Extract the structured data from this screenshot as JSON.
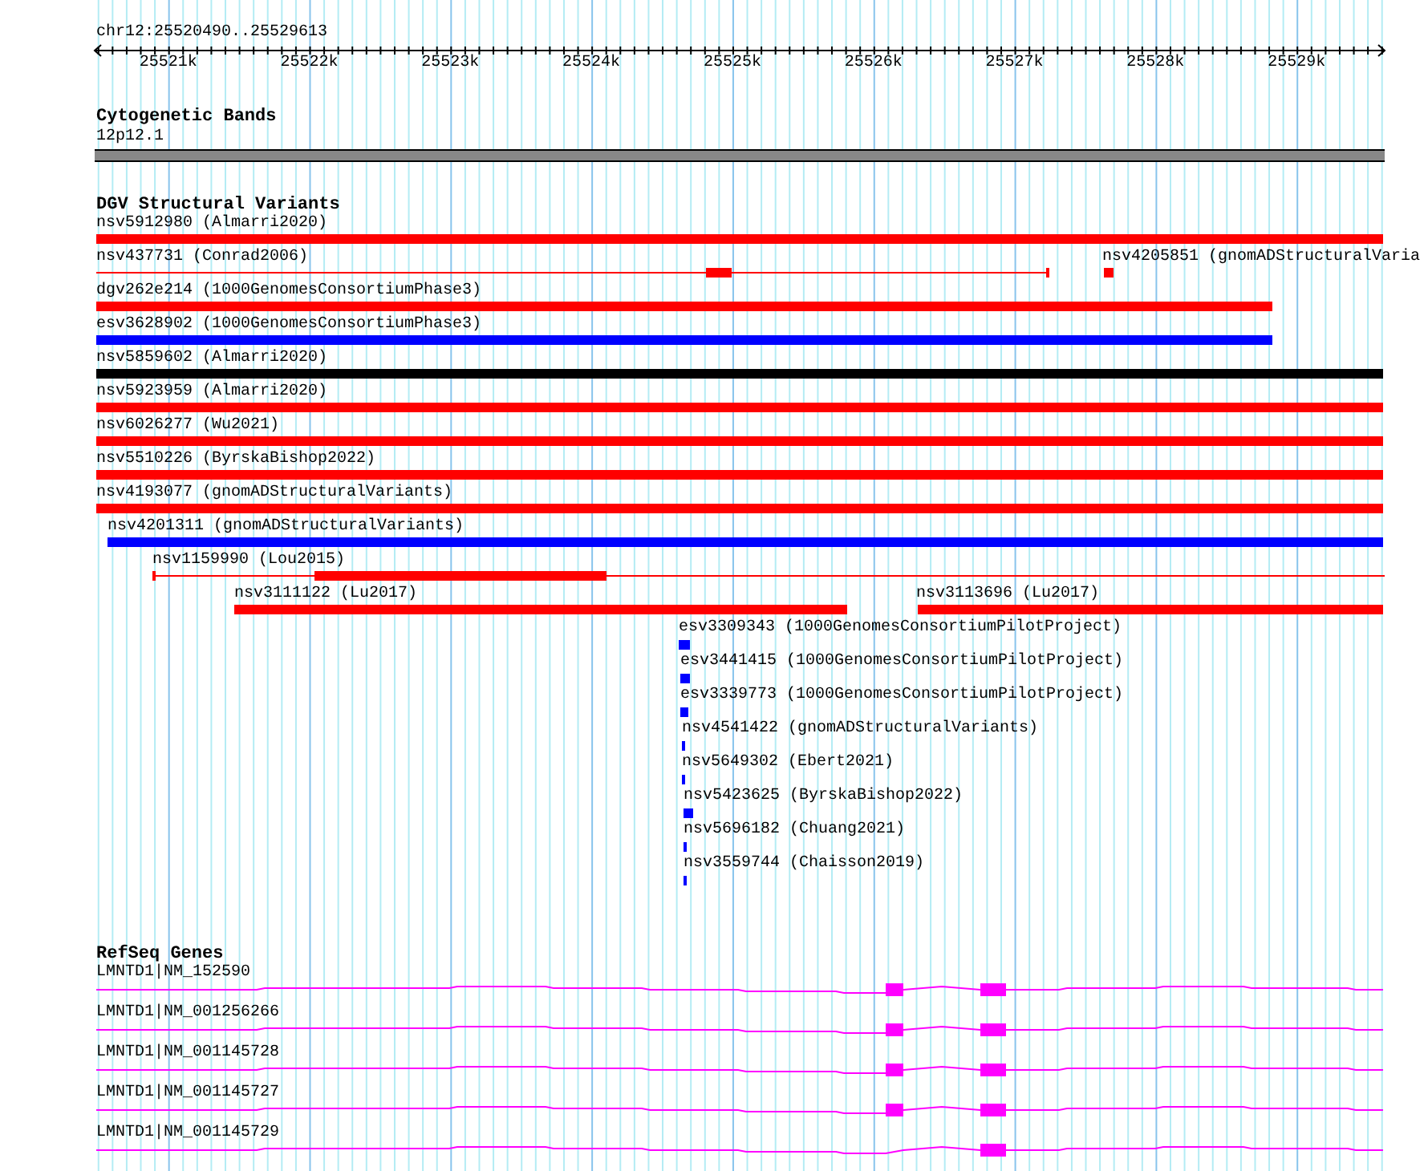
{
  "ruler": {
    "range": "chr12:25520490..25529613",
    "ticks": [
      "25521k",
      "25522k",
      "25523k",
      "25524k",
      "25525k",
      "25526k",
      "25527k",
      "25528k",
      "25529k"
    ]
  },
  "cytoband_track": {
    "title": "Cytogenetic Bands",
    "band": "12p12.1"
  },
  "dgv_track": {
    "title": "DGV Structural Variants",
    "features": [
      {
        "label": "nsv5912980 (Almarri2020)",
        "color": "#ff0000"
      },
      {
        "label": "nsv437731 (Conrad2006)",
        "color": "#ff0000"
      },
      {
        "label": "nsv4205851 (gnomADStructuralVaria",
        "color": "#ff0000"
      },
      {
        "label": "dgv262e214 (1000GenomesConsortiumPhase3)",
        "color": "#ff0000"
      },
      {
        "label": "esv3628902 (1000GenomesConsortiumPhase3)",
        "color": "#0000ff"
      },
      {
        "label": "nsv5859602 (Almarri2020)",
        "color": "#000000"
      },
      {
        "label": "nsv5923959 (Almarri2020)",
        "color": "#ff0000"
      },
      {
        "label": "nsv6026277 (Wu2021)",
        "color": "#ff0000"
      },
      {
        "label": "nsv5510226 (ByrskaBishop2022)",
        "color": "#ff0000"
      },
      {
        "label": "nsv4193077 (gnomADStructuralVariants)",
        "color": "#ff0000"
      },
      {
        "label": "nsv4201311 (gnomADStructuralVariants)",
        "color": "#0000ff"
      },
      {
        "label": "nsv1159990 (Lou2015)",
        "color": "#ff0000"
      },
      {
        "label": "nsv3111122 (Lu2017)",
        "color": "#ff0000"
      },
      {
        "label": "nsv3113696 (Lu2017)",
        "color": "#ff0000"
      },
      {
        "label": "esv3309343 (1000GenomesConsortiumPilotProject)",
        "color": "#0000ff"
      },
      {
        "label": "esv3441415 (1000GenomesConsortiumPilotProject)",
        "color": "#0000ff"
      },
      {
        "label": "esv3339773 (1000GenomesConsortiumPilotProject)",
        "color": "#0000ff"
      },
      {
        "label": "nsv4541422 (gnomADStructuralVariants)",
        "color": "#0000ff"
      },
      {
        "label": "nsv5649302 (Ebert2021)",
        "color": "#0000ff"
      },
      {
        "label": "nsv5423625 (ByrskaBishop2022)",
        "color": "#0000ff"
      },
      {
        "label": "nsv5696182 (Chuang2021)",
        "color": "#0000ff"
      },
      {
        "label": "nsv3559744 (Chaisson2019)",
        "color": "#0000ff"
      }
    ]
  },
  "refseq_track": {
    "title": "RefSeq Genes",
    "genes": [
      {
        "label": "LMNTD1|NM_152590"
      },
      {
        "label": "LMNTD1|NM_001256266"
      },
      {
        "label": "LMNTD1|NM_001145728"
      },
      {
        "label": "LMNTD1|NM_001145727"
      },
      {
        "label": "LMNTD1|NM_001145729"
      }
    ]
  }
}
